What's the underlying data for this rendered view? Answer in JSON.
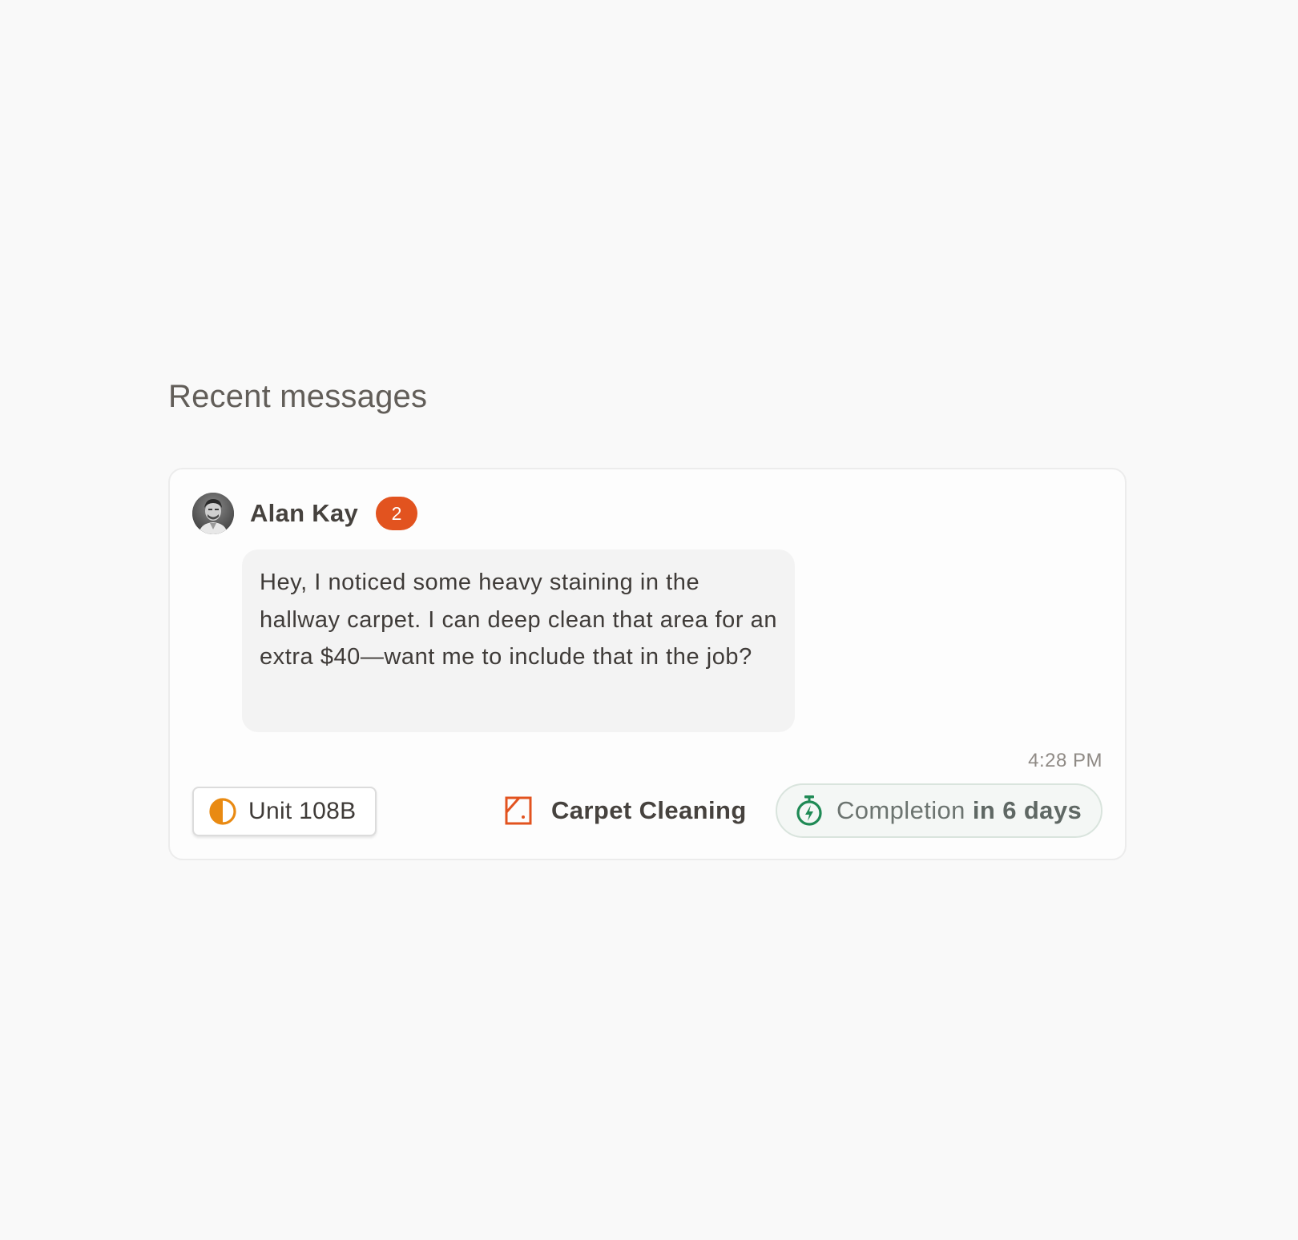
{
  "section": {
    "title": "Recent messages"
  },
  "message": {
    "sender_name": "Alan Kay",
    "unread_count": "2",
    "avatar_icon": "person-photo",
    "body": "Hey, I noticed some heavy staining in the hallway carpet. I can deep clean that area for an extra $40—want me to include that in the job?",
    "time": "4:28 PM"
  },
  "footer": {
    "unit": {
      "label": "Unit 108B",
      "icon": "half-circle-icon",
      "color": "#e98a12"
    },
    "service": {
      "label": "Carpet Cleaning",
      "icon": "carpet-icon",
      "color": "#e2531f"
    },
    "completion": {
      "prefix": "Completion",
      "emphasis": "in 6 days",
      "icon": "stopwatch-bolt-icon",
      "color": "#1f8a55"
    }
  },
  "colors": {
    "background": "#f9f9f9",
    "card": "#fdfdfd",
    "badge": "#e2531f",
    "bubble": "#f3f3f3"
  }
}
